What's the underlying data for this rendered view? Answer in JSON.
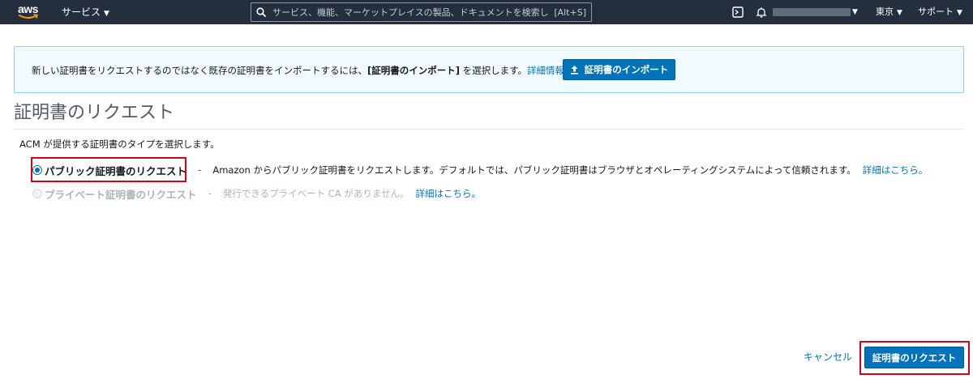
{
  "topbar": {
    "logo_text": "aws",
    "services_label": "サービス",
    "search_placeholder": "サービス、機能、マーケットプレイスの製品、ドキュメントを検索し",
    "search_shortcut": "[Alt+S]",
    "region_label": "東京",
    "support_label": "サポート",
    "icons": [
      "cloudshell-icon",
      "bell-icon"
    ]
  },
  "banner": {
    "text_before": "新しい証明書をリクエストするのではなく既存の証明書をインポートするには、",
    "text_bold": "[証明書のインポート]",
    "text_after": " を選択します。",
    "link": "詳細情報。",
    "import_button": "証明書のインポート"
  },
  "page": {
    "title": "証明書のリクエスト",
    "subtitle": "ACM が提供する証明書のタイプを選択します。"
  },
  "options": [
    {
      "label": "パブリック証明書のリクエスト",
      "separator": "-",
      "description": "Amazon からパブリック証明書をリクエストします。デフォルトでは、パブリック証明書はブラウザとオペレーティングシステムによって信頼されます。",
      "link": "詳細はこちら。",
      "selected": true,
      "disabled": false
    },
    {
      "label": "プライベート証明書のリクエスト",
      "separator": "-",
      "description": "発行できるプライベート CA がありません。",
      "link": "詳細はこちら。",
      "selected": false,
      "disabled": true
    }
  ],
  "footer": {
    "cancel_label": "キャンセル",
    "request_button": "証明書のリクエスト"
  },
  "colors": {
    "topbar_bg": "#232f3e",
    "primary": "#0073bb",
    "highlight": "#d6001c",
    "banner_bg": "#f1faff"
  }
}
